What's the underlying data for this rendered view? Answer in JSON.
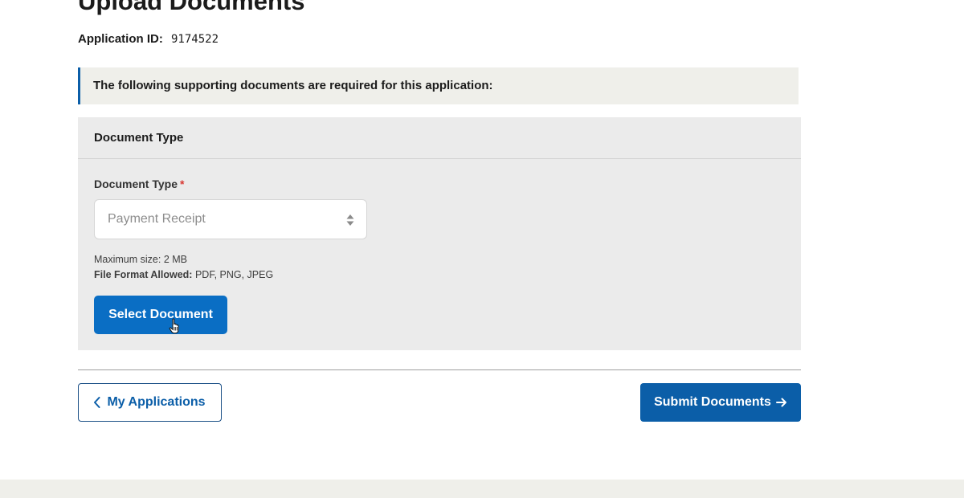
{
  "page": {
    "title": "Upload Documents",
    "application_id_label": "Application ID:",
    "application_id_value": "9174522"
  },
  "notice": {
    "text": "The following supporting documents are required for this application:"
  },
  "document_panel": {
    "header": "Document Type",
    "field_label": "Document Type",
    "required_marker": "*",
    "select_value": "Payment Receipt",
    "max_size_label": "Maximum size:",
    "max_size_value": "2 MB",
    "format_label": "File Format Allowed:",
    "format_value": "PDF, PNG, JPEG",
    "select_button": "Select Document"
  },
  "footer_actions": {
    "back_label": "My Applications",
    "submit_label": "Submit Documents"
  },
  "icons": {
    "back": "chevron-left-icon",
    "submit": "arrow-right-icon",
    "select": "sort-arrows-icon",
    "cursor": "hand-pointer-icon"
  },
  "colors": {
    "primary": "#0b5ea8",
    "select_button": "#0a6ec4",
    "required": "#d83933",
    "notice_bg": "#efefea",
    "panel_bg": "#ebebeb"
  }
}
